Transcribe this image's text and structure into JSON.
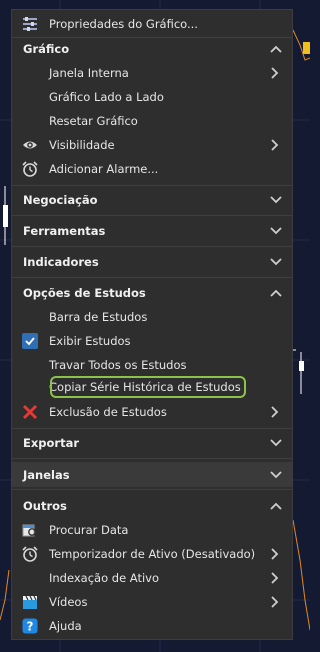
{
  "menu": {
    "header": {
      "label": "Propriedades do Gráfico...",
      "icon": "chart-properties-icon"
    },
    "sections": {
      "grafico": {
        "title": "Gráfico",
        "items": {
          "janela_interna": "Janela Interna",
          "lado_a_lado": "Gráfico Lado a Lado",
          "resetar": "Resetar Gráfico",
          "visibilidade": "Visibilidade",
          "alarme": "Adicionar Alarme..."
        }
      },
      "negociacao": {
        "title": "Negociação"
      },
      "ferramentas": {
        "title": "Ferramentas"
      },
      "indicadores": {
        "title": "Indicadores"
      },
      "opcoes_estudos": {
        "title": "Opções de Estudos",
        "items": {
          "barra": "Barra de Estudos",
          "exibir": "Exibir Estudos",
          "travar": "Travar Todos os Estudos",
          "copiar": "Copiar Série Histórica de Estudos",
          "exclusao": "Exclusão de Estudos"
        }
      },
      "exportar": {
        "title": "Exportar"
      },
      "janelas": {
        "title": "Janelas"
      },
      "outros": {
        "title": "Outros",
        "items": {
          "procurar": "Procurar Data",
          "temporizador": "Temporizador de Ativo (Desativado)",
          "indexacao": "Indexação de Ativo",
          "videos": "Vídeos",
          "ajuda": "Ajuda"
        }
      }
    },
    "colors": {
      "menu_bg": "#2e2e2e",
      "focus_outline": "#8bc34a",
      "check_blue": "#2f6fb5",
      "chart_bg": "#151a33"
    }
  }
}
